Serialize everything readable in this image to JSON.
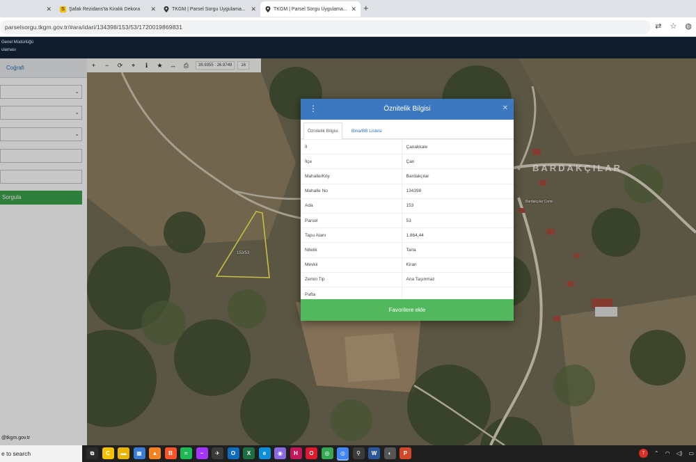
{
  "browser": {
    "tabs": [
      {
        "title": "",
        "favicon": "tab-icon",
        "active": false
      },
      {
        "title": "Şafak Rezidans'ta Kiralık Dekora",
        "favicon": "sh-logo-icon",
        "active": false
      },
      {
        "title": "TKGM | Parsel Sorgu Uygulama...",
        "favicon": "location-pin-icon",
        "active": false
      },
      {
        "title": "TKGM | Parsel Sorgu Uygulama...",
        "favicon": "location-pin-icon",
        "active": true
      }
    ],
    "new_tab": "+",
    "url": "parselsorgu.tkgm.gov.tr/#ara/idari/134398/153/53/1720019869831"
  },
  "app_header": {
    "line1": "Genel Müdürlüğü",
    "line2": "ulaması"
  },
  "left_panel": {
    "tab_label": "Coğrafi",
    "query_button": "Sorgula",
    "footer_email": "@tkgm.gov.tr"
  },
  "map": {
    "coords": "39.9355 : 26.9749",
    "zoom": "16",
    "parcel_label": "153/53",
    "village_label": "BARDAKÇILAR",
    "poi_label": "Bardakçılar Camii"
  },
  "modal": {
    "title": "Öznitelik Bilgisi",
    "tabs": [
      "Öznitelik Bilgisi",
      "Bina/BB Listesi"
    ],
    "rows": [
      {
        "key": "İl",
        "value": "Çanakkale"
      },
      {
        "key": "İlçe",
        "value": "Çan"
      },
      {
        "key": "Mahalle/Köy",
        "value": "Bardakçılar"
      },
      {
        "key": "Mahalle No",
        "value": "134398"
      },
      {
        "key": "Ada",
        "value": "153"
      },
      {
        "key": "Parsel",
        "value": "53"
      },
      {
        "key": "Tapu Alanı",
        "value": "1.864,44"
      },
      {
        "key": "Nitelik",
        "value": "Tarla"
      },
      {
        "key": "Mevkii",
        "value": "Kiran"
      },
      {
        "key": "Zemin Tip",
        "value": "Ana Taşınmaz"
      },
      {
        "key": "Pafta",
        "value": ""
      }
    ],
    "favorite_button": "Favorilere ekle"
  },
  "taskbar": {
    "search_text": "e to search",
    "apps": [
      {
        "name": "task-view-icon",
        "glyph": "⧉",
        "color": "#2b2b2b"
      },
      {
        "name": "yellow-app-icon",
        "glyph": "C",
        "color": "#f2c200"
      },
      {
        "name": "file-explorer-icon",
        "glyph": "▬",
        "color": "#e8b400"
      },
      {
        "name": "store-icon",
        "glyph": "▦",
        "color": "#3a7bd5"
      },
      {
        "name": "vlc-icon",
        "glyph": "▲",
        "color": "#f58220"
      },
      {
        "name": "brave-icon",
        "glyph": "B",
        "color": "#fb542b"
      },
      {
        "name": "spotify-icon",
        "glyph": "≈",
        "color": "#1db954"
      },
      {
        "name": "messenger-icon",
        "glyph": "~",
        "color": "#a334fa"
      },
      {
        "name": "wifi-tool-icon",
        "glyph": "✈",
        "color": "#3b3b3b"
      },
      {
        "name": "outlook-icon",
        "glyph": "O",
        "color": "#0f6cbd"
      },
      {
        "name": "excel-icon",
        "glyph": "X",
        "color": "#1d6f42"
      },
      {
        "name": "edge-icon",
        "glyph": "e",
        "color": "#0c8fd8"
      },
      {
        "name": "app-icon",
        "glyph": "◉",
        "color": "#8a6adf"
      },
      {
        "name": "h-app-icon",
        "glyph": "H",
        "color": "#c2185b"
      },
      {
        "name": "opera-icon",
        "glyph": "O",
        "color": "#e0182d"
      },
      {
        "name": "chrome-icon",
        "glyph": "◎",
        "color": "#34a853"
      },
      {
        "name": "chrome-active-icon",
        "glyph": "◎",
        "color": "#4285f4",
        "active": true
      },
      {
        "name": "network-icon",
        "glyph": "⚲",
        "color": "#3b3b3b"
      },
      {
        "name": "word-icon",
        "glyph": "W",
        "color": "#2b579a"
      },
      {
        "name": "steam-icon",
        "glyph": "◐",
        "color": "#555555"
      },
      {
        "name": "powerpoint-icon",
        "glyph": "P",
        "color": "#d24726"
      }
    ],
    "tray_avatar": "T"
  },
  "colors": {
    "modal_header": "#3c78bf",
    "favorite_button": "#52b85e",
    "query_button": "#3da34d",
    "app_header": "#0e1c2c"
  }
}
